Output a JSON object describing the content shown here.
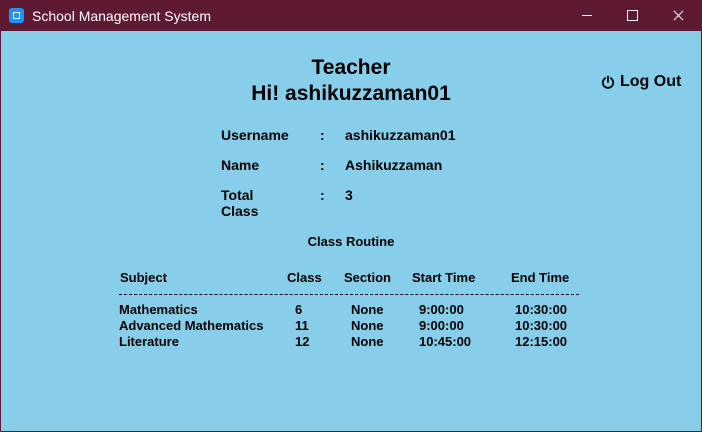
{
  "window": {
    "title": "School Management System"
  },
  "header": {
    "role": "Teacher",
    "greeting": "Hi! ashikuzzaman01",
    "logout_label": "Log Out"
  },
  "profile": {
    "colon": ":",
    "rows": [
      {
        "label": "Username",
        "value": "ashikuzzaman01"
      },
      {
        "label": "Name",
        "value": "Ashikuzzaman"
      },
      {
        "label": "Total Class",
        "value": "3"
      }
    ]
  },
  "routine": {
    "title": "Class Routine",
    "columns": [
      "Subject",
      "Class",
      "Section",
      "Start Time",
      "End Time"
    ],
    "rows": [
      [
        "Mathematics",
        "6",
        "None",
        "9:00:00",
        "10:30:00"
      ],
      [
        "Advanced Mathematics",
        "11",
        "None",
        "9:00:00",
        "10:30:00"
      ],
      [
        "Literature",
        "12",
        "None",
        "10:45:00",
        "12:15:00"
      ]
    ]
  },
  "colors": {
    "titlebar": "#5e1a33",
    "background": "#87ceeb",
    "app_icon": "#1e90ff"
  },
  "icons": {
    "app": "app-icon",
    "logout": "power-icon"
  }
}
